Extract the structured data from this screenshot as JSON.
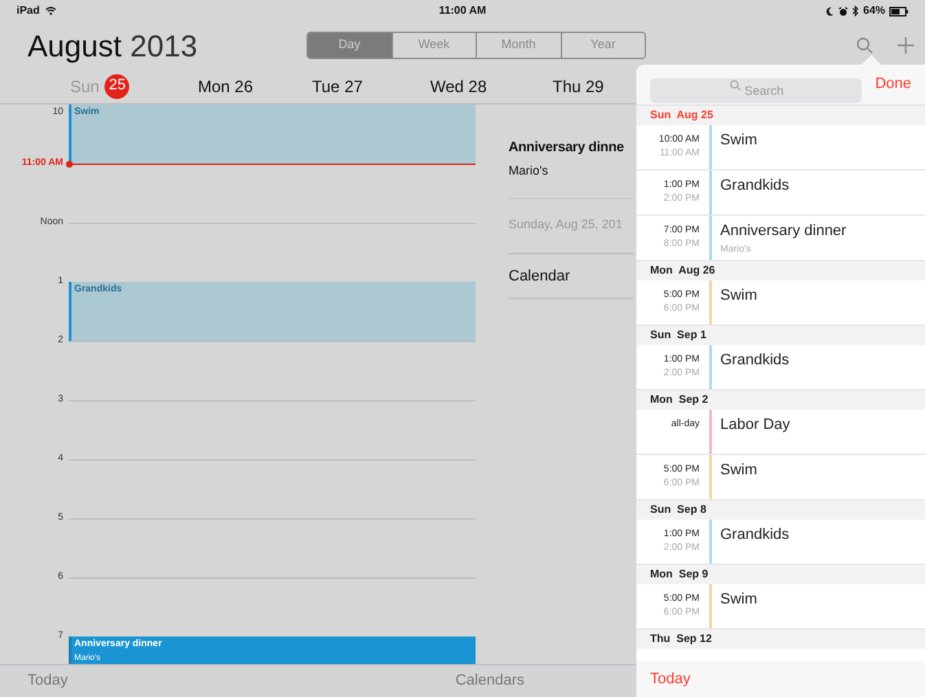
{
  "status_bar": {
    "device": "iPad",
    "time": "11:00 AM",
    "battery": "64%"
  },
  "header": {
    "month": "August",
    "year": "2013"
  },
  "view_tabs": [
    {
      "label": "Day",
      "selected": true
    },
    {
      "label": "Week",
      "selected": false
    },
    {
      "label": "Month",
      "selected": false
    },
    {
      "label": "Year",
      "selected": false
    }
  ],
  "days": [
    {
      "name": "Sun",
      "date": "25",
      "today": true
    },
    {
      "name": "Mon",
      "date": "26",
      "today": false
    },
    {
      "name": "Tue",
      "date": "27",
      "today": false
    },
    {
      "name": "Wed",
      "date": "28",
      "today": false
    },
    {
      "name": "Thu",
      "date": "29",
      "today": false
    }
  ],
  "timeline": [
    {
      "label": "10",
      "kind": "hour",
      "event": {
        "title": "Swim",
        "selected": false
      }
    },
    {
      "label": "11:00 AM",
      "kind": "now"
    },
    {
      "label": "Noon",
      "kind": "hour"
    },
    {
      "label": "1",
      "kind": "hour",
      "event": {
        "title": "Grandkids",
        "selected": false
      }
    },
    {
      "label": "2",
      "kind": "hour"
    },
    {
      "label": "3",
      "kind": "hour"
    },
    {
      "label": "4",
      "kind": "hour"
    },
    {
      "label": "5",
      "kind": "hour"
    },
    {
      "label": "6",
      "kind": "hour"
    },
    {
      "label": "7",
      "kind": "hour",
      "event": {
        "title": "Anniversary dinner",
        "location": "Mario's",
        "selected": true
      }
    }
  ],
  "event_detail": {
    "title": "Anniversary dinne",
    "location": "Mario's",
    "date": "Sunday, Aug 25, 201",
    "calendar_label": "Calendar"
  },
  "toolbar": {
    "today": "Today",
    "calendars": "Calendars"
  },
  "search_popover": {
    "search": {
      "placeholder": "Search"
    },
    "done": "Done",
    "today": "Today",
    "sections": [
      {
        "date": "Sun  Aug 25",
        "today": true,
        "events": [
          {
            "start": "10:00 AM",
            "end": "11:00 AM",
            "title": "Swim",
            "color": "#a9d9f2"
          },
          {
            "start": "1:00 PM",
            "end": "2:00 PM",
            "title": "Grandkids",
            "color": "#a9d9f2"
          },
          {
            "start": "7:00 PM",
            "end": "8:00 PM",
            "title": "Anniversary dinner",
            "location": "Mario's",
            "color": "#a9d9f2"
          }
        ]
      },
      {
        "date": "Mon  Aug 26",
        "today": false,
        "events": [
          {
            "start": "5:00 PM",
            "end": "6:00 PM",
            "title": "Swim",
            "color": "#f8d49d"
          }
        ]
      },
      {
        "date": "Sun  Sep 1",
        "today": false,
        "events": [
          {
            "start": "1:00 PM",
            "end": "2:00 PM",
            "title": "Grandkids",
            "color": "#a9d9f2"
          }
        ]
      },
      {
        "date": "Mon  Sep 2",
        "today": false,
        "events": [
          {
            "start": "all-day",
            "title": "Labor Day",
            "color": "#f5b5c4"
          },
          {
            "start": "5:00 PM",
            "end": "6:00 PM",
            "title": "Swim",
            "color": "#f8d49d"
          }
        ]
      },
      {
        "date": "Sun  Sep 8",
        "today": false,
        "events": [
          {
            "start": "1:00 PM",
            "end": "2:00 PM",
            "title": "Grandkids",
            "color": "#a9d9f2"
          }
        ]
      },
      {
        "date": "Mon  Sep 9",
        "today": false,
        "events": [
          {
            "start": "5:00 PM",
            "end": "6:00 PM",
            "title": "Swim",
            "color": "#f8d49d"
          }
        ]
      },
      {
        "date": "Thu  Sep 12",
        "today": false
      }
    ]
  }
}
